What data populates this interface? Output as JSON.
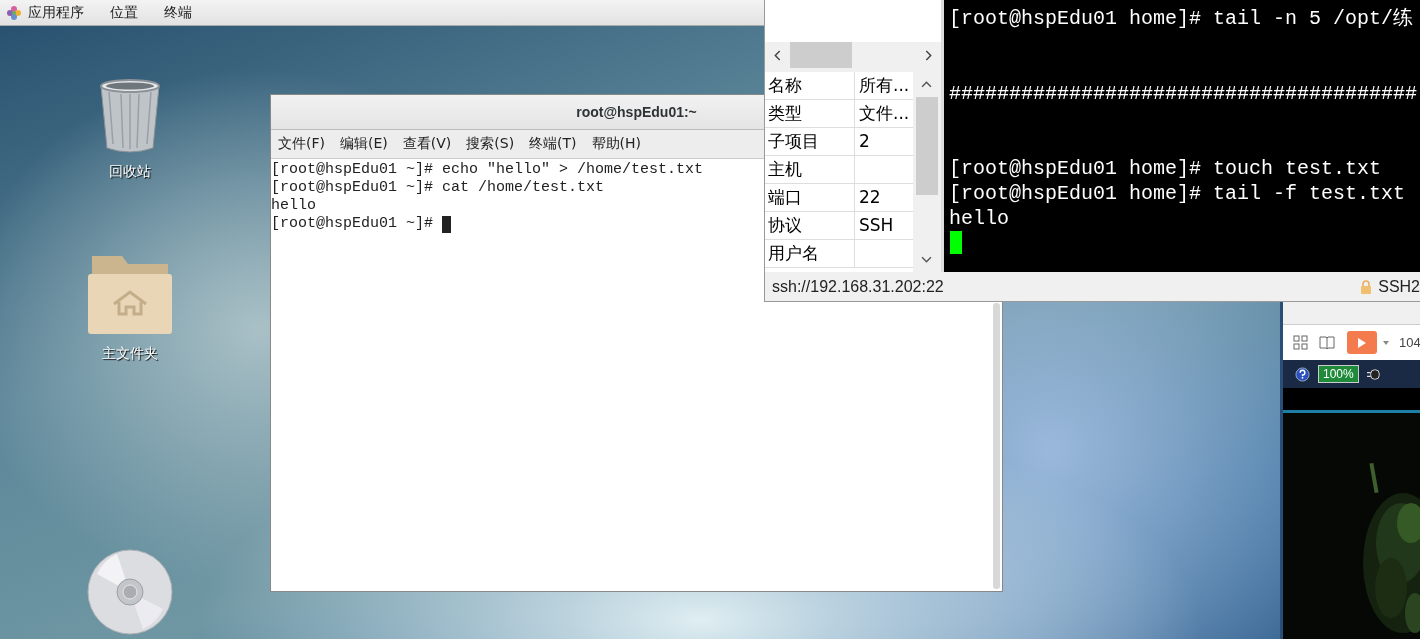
{
  "top_bar": {
    "menus": [
      "应用程序",
      "位置",
      "终端"
    ]
  },
  "desktop_icons": [
    {
      "kind": "trash",
      "label": "回收站"
    },
    {
      "kind": "home-folder",
      "label": "主文件夹"
    },
    {
      "kind": "disc"
    }
  ],
  "terminal_window": {
    "title": "root@hspEdu01:~",
    "menu": [
      "文件(F)",
      "编辑(E)",
      "查看(V)",
      "搜索(S)",
      "终端(T)",
      "帮助(H)"
    ],
    "lines": [
      "[root@hspEdu01 ~]# echo \"hello\" > /home/test.txt",
      "[root@hspEdu01 ~]# cat /home/test.txt",
      "hello",
      "[root@hspEdu01 ~]# "
    ]
  },
  "ssh_window": {
    "properties": [
      {
        "name": "名称",
        "value": "所有..."
      },
      {
        "name": "类型",
        "value": "文件..."
      },
      {
        "name": "子项目",
        "value": "2"
      },
      {
        "name": "主机"
      },
      {
        "name": "端口",
        "value": "22"
      },
      {
        "name": "协议",
        "value": "SSH"
      },
      {
        "name": "用户名"
      }
    ],
    "terminal_lines": [
      {
        "kind": "command",
        "text": "[root@hspEdu01 home]# tail -n 5 /opt/练"
      },
      {
        "kind": "banner",
        "text": "#######################################"
      },
      {
        "kind": "command",
        "text": "[root@hspEdu01 home]# touch test.txt"
      },
      {
        "kind": "command",
        "text": "[root@hspEdu01 home]# tail -f test.txt"
      },
      {
        "kind": "output",
        "text": "hello"
      }
    ],
    "status_bar": {
      "address": "ssh://192.168.31.202:22",
      "protocol": "SSH2"
    }
  },
  "viewer_window": {
    "toolbar_text": "104",
    "battery": "100%"
  }
}
